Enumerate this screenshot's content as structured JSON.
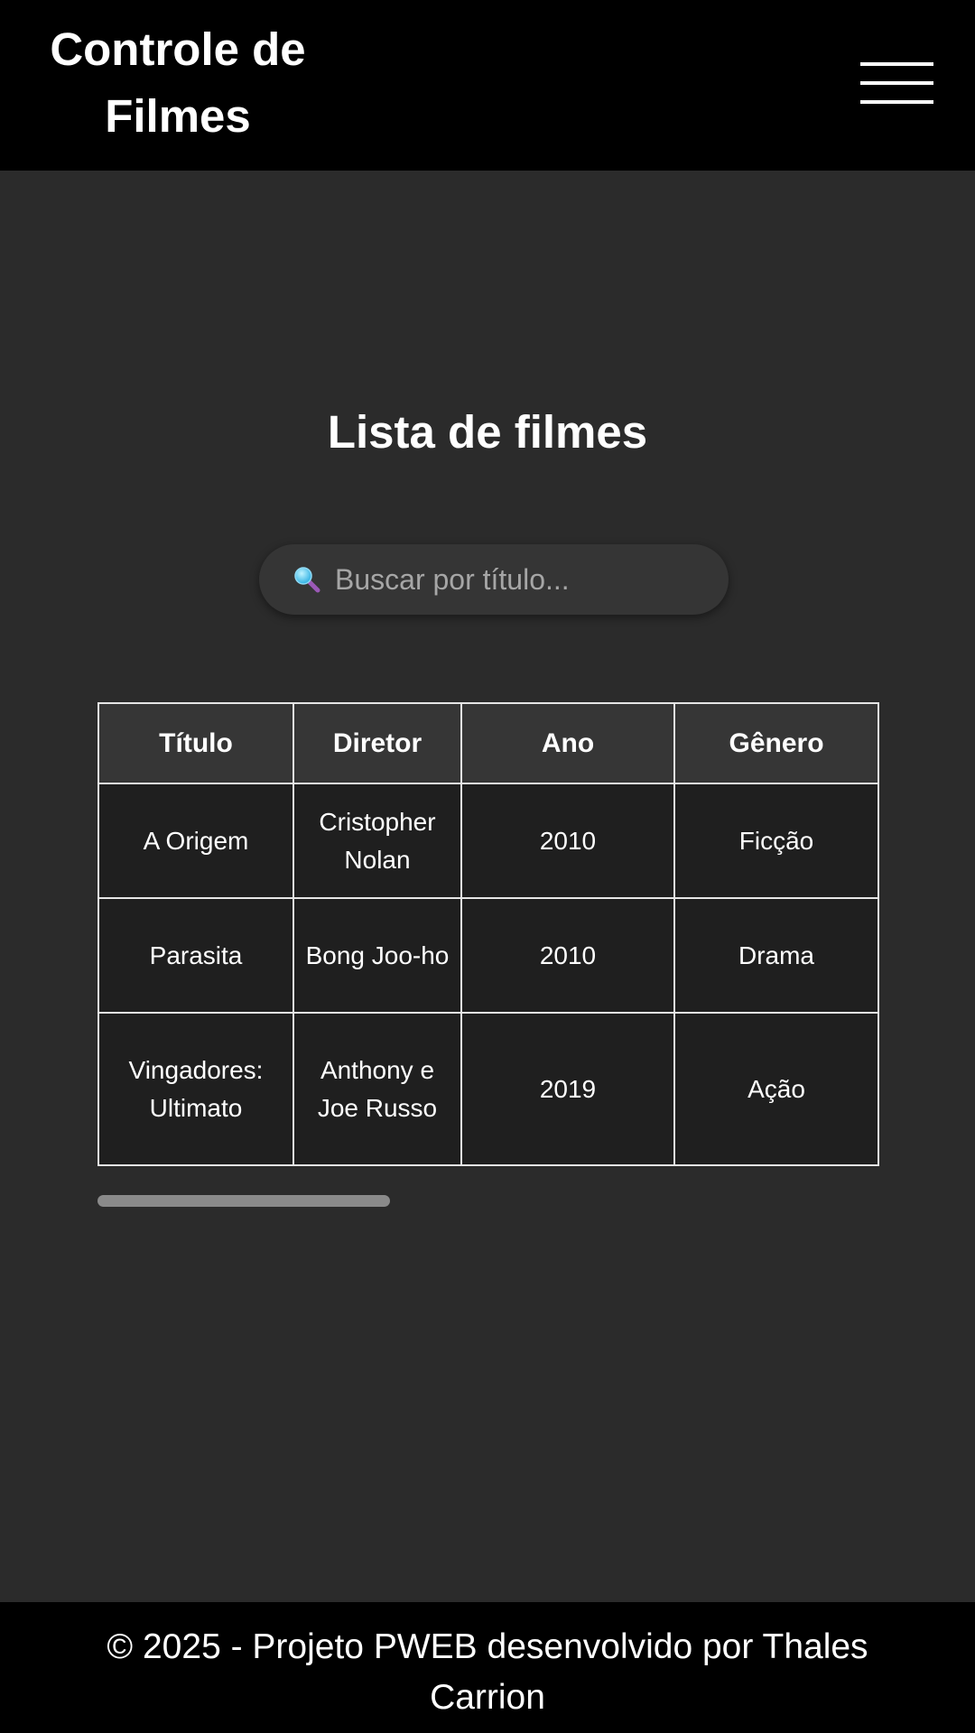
{
  "header": {
    "title": "Controle de Filmes",
    "menu_icon": "hamburger-menu-icon"
  },
  "main": {
    "heading": "Lista de filmes",
    "search": {
      "placeholder": "Buscar por título...",
      "value": "",
      "icon": "magnifying-glass-icon"
    },
    "table": {
      "columns": [
        "Título",
        "Diretor",
        "Ano",
        "Gênero"
      ],
      "rows": [
        {
          "titulo": "A Origem",
          "diretor": "Cristopher Nolan",
          "ano": "2010",
          "genero": "Ficção"
        },
        {
          "titulo": "Parasita",
          "diretor": "Bong Joo-ho",
          "ano": "2010",
          "genero": "Drama"
        },
        {
          "titulo": "Vingadores: Ultimato",
          "diretor": "Anthony e Joe Russo",
          "ano": "2019",
          "genero": "Ação"
        }
      ]
    }
  },
  "footer": {
    "text": "© 2025 - Projeto PWEB desenvolvido por Thales Carrion"
  },
  "colors": {
    "header_bg": "#000000",
    "page_bg": "#2b2b2b",
    "table_header_bg": "#363636",
    "table_cell_bg": "#1f1f1f",
    "border": "#e6e6e6"
  }
}
